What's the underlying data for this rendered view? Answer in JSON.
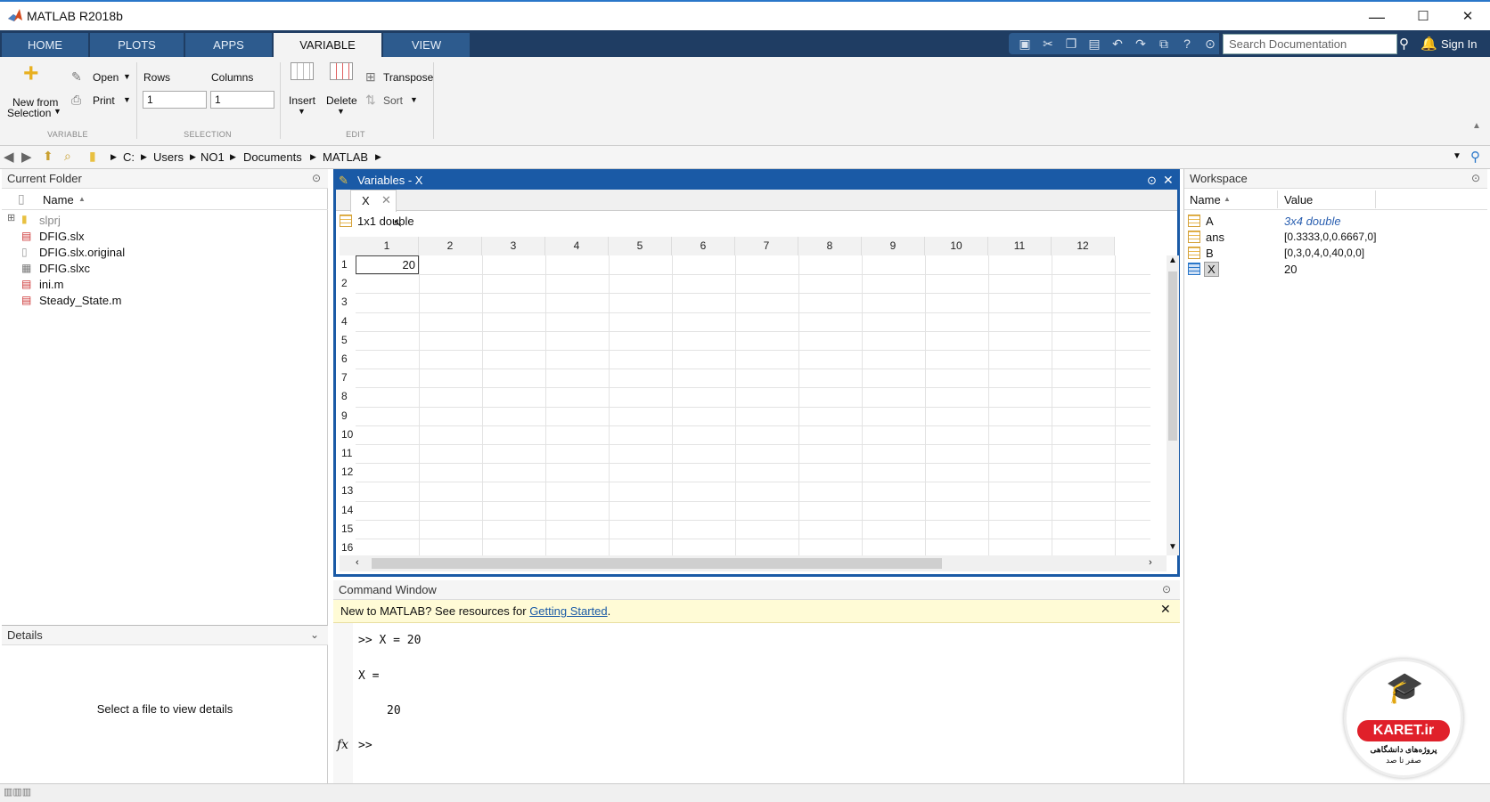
{
  "window": {
    "title": "MATLAB R2018b",
    "min": "—",
    "max": "☐",
    "close": "✕"
  },
  "tabs": [
    {
      "label": "HOME"
    },
    {
      "label": "PLOTS"
    },
    {
      "label": "APPS"
    },
    {
      "label": "VARIABLE"
    },
    {
      "label": "VIEW"
    }
  ],
  "search": {
    "placeholder": "Search Documentation"
  },
  "sign_in": "Sign In",
  "ribbon": {
    "new_from": "New from",
    "selection": "Selection",
    "open": "Open",
    "print": "Print",
    "rows_label": "Rows",
    "columns_label": "Columns",
    "rows_value": "1",
    "columns_value": "1",
    "insert": "Insert",
    "delete": "Delete",
    "transpose": "Transpose",
    "sort": "Sort",
    "group_variable": "VARIABLE",
    "group_selection": "SELECTION",
    "group_edit": "EDIT"
  },
  "address": {
    "parts": [
      "C:",
      "Users",
      "NO1",
      "Documents",
      "MATLAB"
    ]
  },
  "current_folder": {
    "title": "Current Folder",
    "col_name": "Name",
    "files": [
      "slprj",
      "DFIG.slx",
      "DFIG.slx.original",
      "DFIG.slxc",
      "ini.m",
      "Steady_State.m"
    ]
  },
  "details": {
    "title": "Details",
    "message": "Select a file to view details"
  },
  "variables": {
    "title": "Variables - X",
    "tab": "X",
    "info": "1x1 double",
    "cols": [
      "1",
      "2",
      "3",
      "4",
      "5",
      "6",
      "7",
      "8",
      "9",
      "10",
      "11",
      "12"
    ],
    "rows": [
      "1",
      "2",
      "3",
      "4",
      "5",
      "6",
      "7",
      "8",
      "9",
      "10",
      "11",
      "12",
      "13",
      "14",
      "15",
      "16"
    ],
    "cell_value": "20"
  },
  "command_window": {
    "title": "Command Window",
    "banner": "New to MATLAB? See resources for ",
    "banner_link": "Getting Started",
    "banner_end": ".",
    "line1": ">> X = 20",
    "line2": "X =",
    "line3": "20",
    "prompt": ">>",
    "fx": "fx"
  },
  "workspace": {
    "title": "Workspace",
    "col_name": "Name",
    "col_value": "Value",
    "vars": [
      {
        "name": "A",
        "value": "3x4 double"
      },
      {
        "name": "ans",
        "value": "[0.3333,0,0.6667,0]"
      },
      {
        "name": "B",
        "value": "[0,3,0,4,0,40,0,0]"
      },
      {
        "name": "X",
        "value": "20"
      }
    ]
  },
  "watermark": {
    "brand": "KARET.ir",
    "line1": "پروژه‌های دانشگاهی",
    "line2": "صفر تا صد"
  }
}
